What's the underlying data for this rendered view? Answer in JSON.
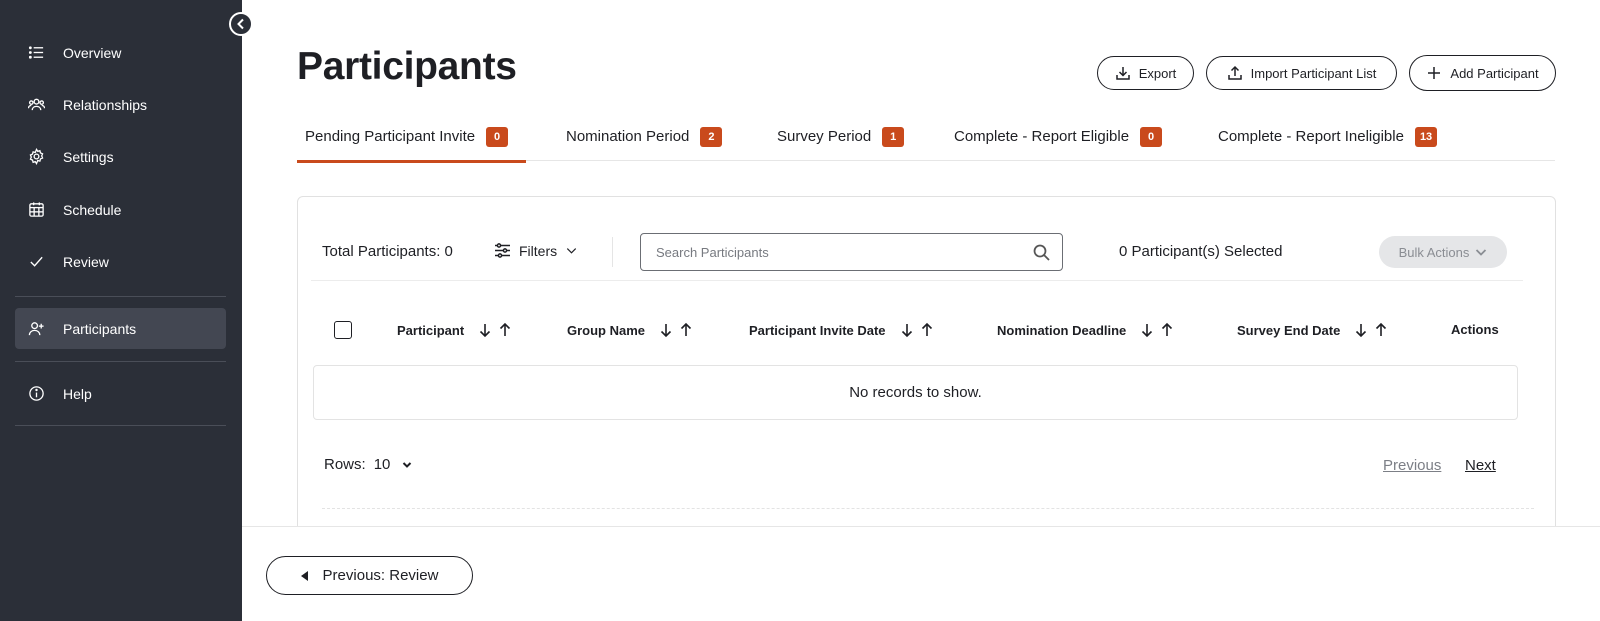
{
  "sidebar": {
    "items": [
      {
        "label": "Overview",
        "icon": "list-icon"
      },
      {
        "label": "Relationships",
        "icon": "people-icon"
      },
      {
        "label": "Settings",
        "icon": "gear-icon"
      },
      {
        "label": "Schedule",
        "icon": "calendar-icon"
      },
      {
        "label": "Review",
        "icon": "check-icon"
      },
      {
        "label": "Participants",
        "icon": "add-person-icon",
        "active": true
      },
      {
        "label": "Help",
        "icon": "info-icon"
      }
    ]
  },
  "header": {
    "title": "Participants",
    "export_label": "Export",
    "import_label": "Import Participant List",
    "add_label": "Add Participant"
  },
  "tabs": [
    {
      "label": "Pending Participant Invite",
      "count": "0",
      "active": true
    },
    {
      "label": "Nomination Period",
      "count": "2"
    },
    {
      "label": "Survey Period",
      "count": "1"
    },
    {
      "label": "Complete - Report Eligible",
      "count": "0"
    },
    {
      "label": "Complete - Report Ineligible",
      "count": "13"
    }
  ],
  "toolbar": {
    "total_label": "Total Participants: 0",
    "filters_label": "Filters",
    "search_placeholder": "Search Participants",
    "selected_label": "0 Participant(s) Selected",
    "bulk_label": "Bulk Actions"
  },
  "table": {
    "columns": [
      "Participant",
      "Group Name",
      "Participant Invite Date",
      "Nomination Deadline",
      "Survey End Date",
      "Actions"
    ],
    "empty_text": "No records to show."
  },
  "pagination": {
    "rows_label": "Rows:",
    "rows_value": "10",
    "previous_label": "Previous",
    "next_label": "Next"
  },
  "footer": {
    "prev_step_label": "Previous: Review"
  },
  "colors": {
    "sidebar_bg": "#2b2f38",
    "accent": "#c94a1c"
  }
}
